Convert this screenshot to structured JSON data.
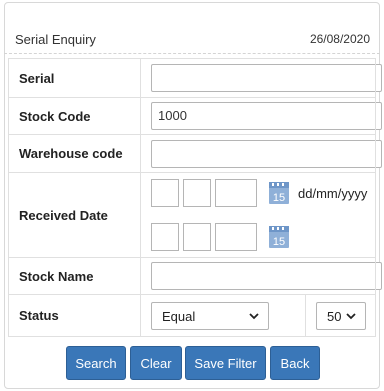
{
  "header": {
    "title": "Serial Enquiry",
    "date": "26/08/2020"
  },
  "form": {
    "serial_label": "Serial",
    "serial_value": "",
    "stock_code_label": "Stock Code",
    "stock_code_value": "1000",
    "warehouse_label": "Warehouse code",
    "warehouse_value": "",
    "received_date_label": "Received Date",
    "date_format": "dd/mm/yyyy",
    "calendar_day": "15",
    "stock_name_label": "Stock Name",
    "stock_name_value": "",
    "status_label": "Status",
    "status_operator": "Equal",
    "status_value": "50"
  },
  "buttons": {
    "search": "Search",
    "clear": "Clear",
    "save_filter": "Save Filter",
    "back": "Back"
  },
  "colors": {
    "button": "#3a77b8",
    "calendar_icon": "#8fb0d8"
  },
  "icons": [
    "calendar-icon",
    "chevron-down-icon"
  ]
}
